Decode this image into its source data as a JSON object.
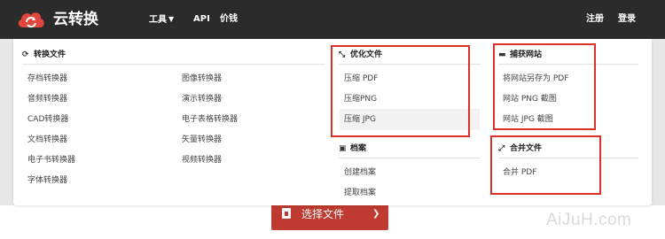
{
  "brand": {
    "name": "云转换",
    "logo_icon": "cloud-sync-icon",
    "logo_color": "#e2463c"
  },
  "top_nav": {
    "tools": "工具",
    "api": "API",
    "pricing": "价钱",
    "signup": "注册",
    "login": "登录"
  },
  "menu": {
    "convert": {
      "title": "转换文件",
      "icon": "refresh-icon",
      "col1": [
        "存档转换器",
        "音频转换器",
        "CAD转换器",
        "文档转换器",
        "电子书转换器",
        "字体转换器"
      ],
      "col2": [
        "图像转换器",
        "演示转换器",
        "电子表格转换器",
        "矢量转换器",
        "视频转换器"
      ]
    },
    "optimize": {
      "title": "优化文件",
      "icon": "compress-icon",
      "items": [
        "压缩 PDF",
        "压缩PNG",
        "压缩 JPG"
      ],
      "highlighted": "压缩 JPG"
    },
    "archive": {
      "title": "档案",
      "icon": "archive-box-icon",
      "items": [
        "创建档案",
        "提取档案"
      ]
    },
    "capture": {
      "title": "捕获网站",
      "icon": "browser-window-icon",
      "items": [
        "将网站另存为 PDF",
        "网站 PNG 截图",
        "网站 JPG 截图"
      ]
    },
    "merge": {
      "title": "合并文件",
      "icon": "merge-arrows-icon",
      "items": [
        "合并 PDF"
      ]
    }
  },
  "main": {
    "select_button": "选择文件",
    "button_color": "#bf3a30"
  },
  "watermark": "AiJuH.com",
  "annotation_color": "#d9302a"
}
